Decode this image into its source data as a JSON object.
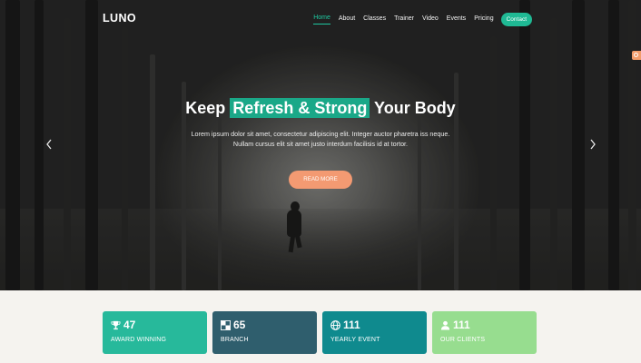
{
  "brand": "LUNO",
  "nav": {
    "items": [
      {
        "label": "Home",
        "active": true
      },
      {
        "label": "About"
      },
      {
        "label": "Classes"
      },
      {
        "label": "Trainer"
      },
      {
        "label": "Video"
      },
      {
        "label": "Events"
      },
      {
        "label": "Pricing"
      }
    ],
    "contact_label": "Contact"
  },
  "hero": {
    "title_before": "Keep",
    "title_highlight": "Refresh & Strong",
    "title_after": "Your Body",
    "subtitle_line1": "Lorem ipsum dolor sit amet, consectetur adipiscing elit. Integer auctor pharetra iss neque.",
    "subtitle_line2": "Nullam cursus elit sit amet justo interdum facilisis id at tortor.",
    "button_label": "READ MORE",
    "prev_icon": "chevron-left-icon",
    "next_icon": "chevron-right-icon"
  },
  "stats": [
    {
      "icon": "trophy-icon",
      "value": "47",
      "label": "AWARD WINNING",
      "color": "#27b99b"
    },
    {
      "icon": "checker-icon",
      "value": "65",
      "label": "BRANCH",
      "color": "#2f5e6d"
    },
    {
      "icon": "globe-icon",
      "value": "111",
      "label": "YEARLY EVENT",
      "color": "#0f8a8e"
    },
    {
      "icon": "user-icon",
      "value": "111",
      "label": "OUR CLIENTS",
      "color": "#97dd8f"
    }
  ],
  "colors": {
    "accent": "#1fb994",
    "highlight": "#1aa888",
    "cta": "#f39a72",
    "section_bg": "#f5f3ef"
  }
}
